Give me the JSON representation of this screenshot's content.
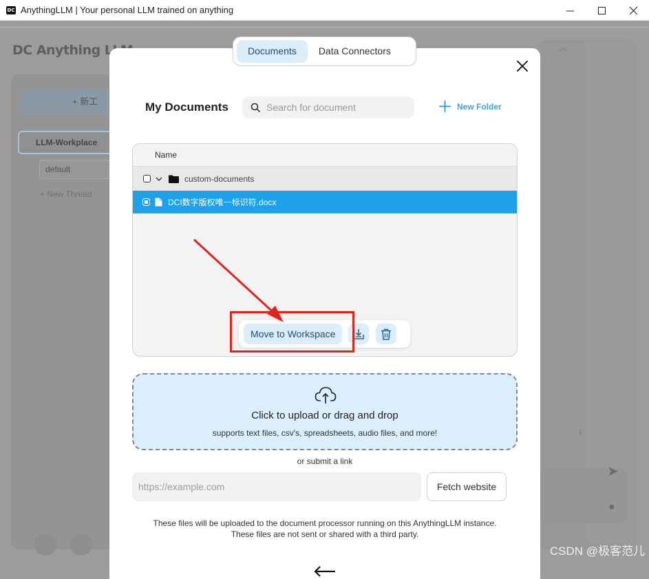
{
  "window": {
    "title": "AnythingLLM | Your personal LLM trained on anything",
    "logo_text": "DC"
  },
  "background_app": {
    "logo": "DC Anything LLM",
    "new_workspace_label": "+ 新工",
    "workspace_label": "LLM-Workplace",
    "thread_default": "default",
    "new_thread": "+ New Thread"
  },
  "modal": {
    "tabs": [
      {
        "label": "Documents",
        "active": true
      },
      {
        "label": "Data Connectors",
        "active": false
      }
    ],
    "title": "My Documents",
    "search": {
      "placeholder": "Search for document",
      "value": ""
    },
    "new_folder_label": "New Folder",
    "file_list": {
      "column_header": "Name",
      "folder": {
        "name": "custom-documents",
        "expanded": true
      },
      "files": [
        {
          "name": "DCI数字版权唯一标识符.docx",
          "selected": true
        }
      ]
    },
    "actions": {
      "move_label": "Move to Workspace",
      "icons": [
        "download-icon",
        "trash-icon"
      ]
    },
    "upload": {
      "title": "Click to upload or drag and drop",
      "subtitle": "supports text files, csv's, spreadsheets, audio files, and more!"
    },
    "submit_link_label": "or submit a link",
    "url": {
      "placeholder": "https://example.com",
      "value": ""
    },
    "fetch_label": "Fetch website",
    "note_line1": "These files will be uploaded to the document processor running on this AnythingLLM instance.",
    "note_line2": "These files are not sent or shared with a third party."
  },
  "annotation": {
    "color": "#e2231a"
  },
  "watermark": "CSDN @极客范儿",
  "colors": {
    "accent": "#1ea1e8",
    "accent_light": "#dbedf9",
    "link_blue": "#38a3e6"
  }
}
